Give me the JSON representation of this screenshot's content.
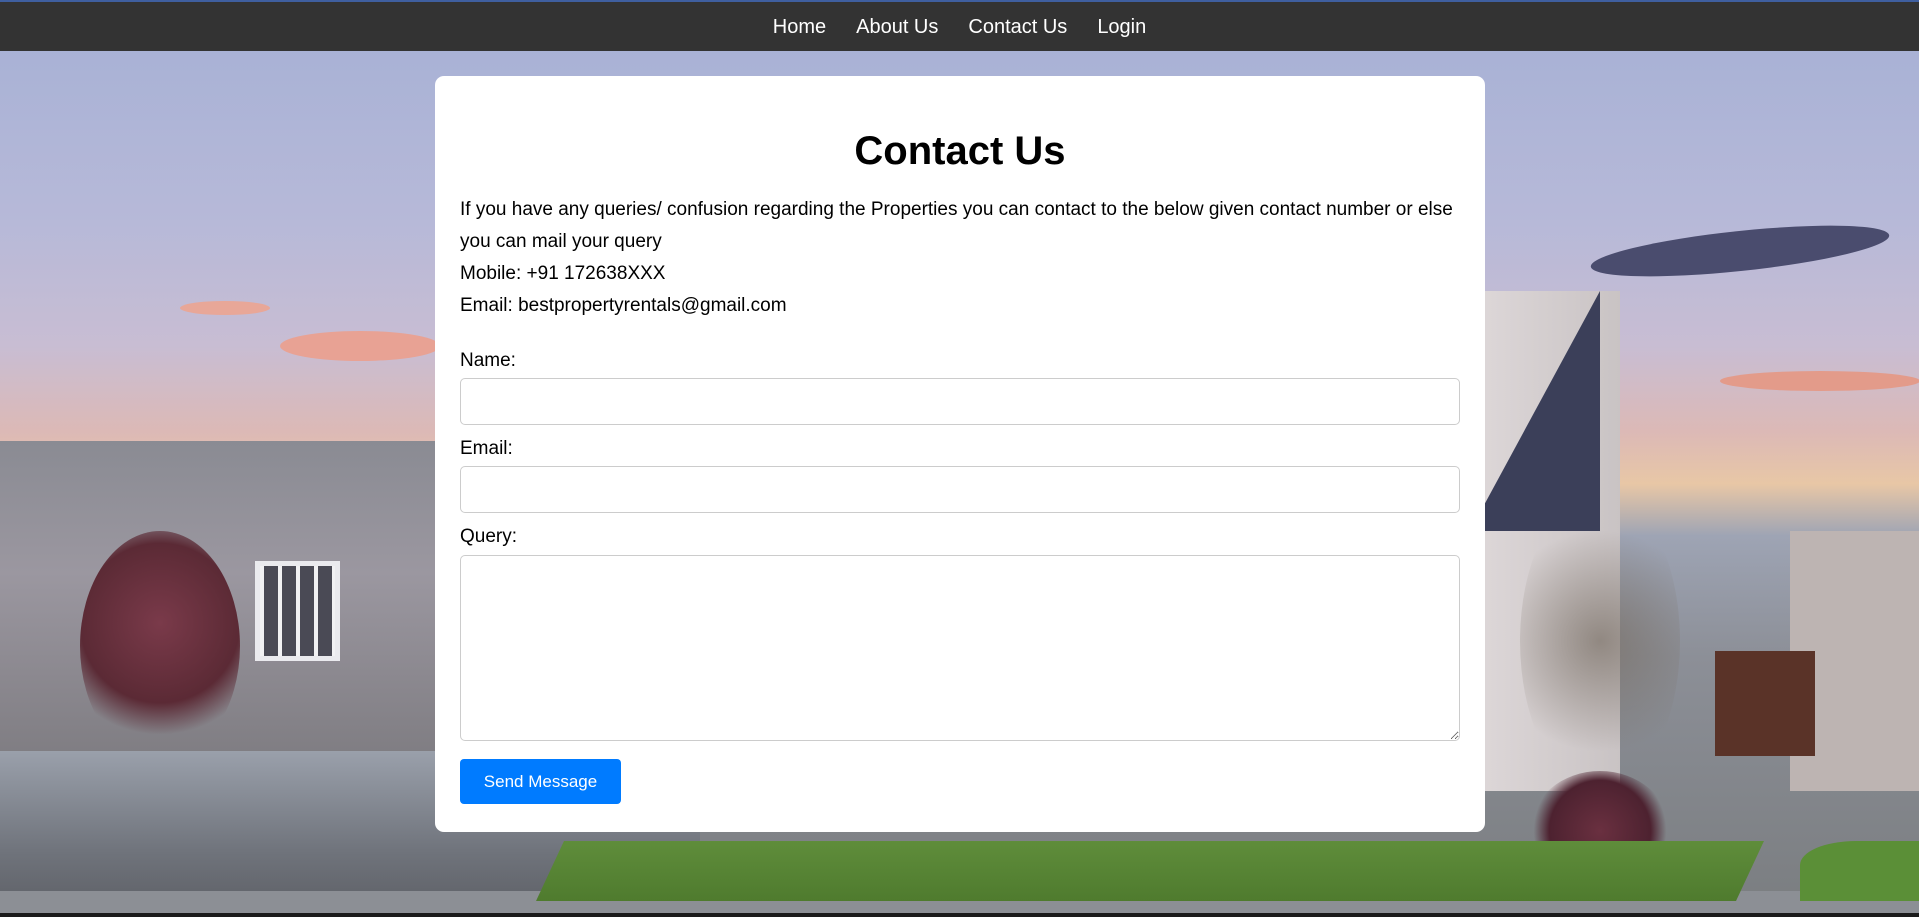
{
  "nav": {
    "items": [
      {
        "label": "Home"
      },
      {
        "label": "About Us"
      },
      {
        "label": "Contact Us"
      },
      {
        "label": "Login"
      }
    ]
  },
  "contact": {
    "title": "Contact Us",
    "intro_text": "If you have any queries/ confusion regarding the Properties you can contact to the below given contact number or else you can mail your query",
    "mobile": "Mobile: +91 172638XXX",
    "email_line": "Email: bestpropertyrentals@gmail.com"
  },
  "form": {
    "name_label": "Name:",
    "name_value": "",
    "email_label": "Email:",
    "email_value": "",
    "query_label": "Query:",
    "query_value": "",
    "submit_label": "Send Message"
  },
  "colors": {
    "nav_bg": "#333333",
    "accent": "#007bff",
    "card_bg": "#ffffff"
  }
}
